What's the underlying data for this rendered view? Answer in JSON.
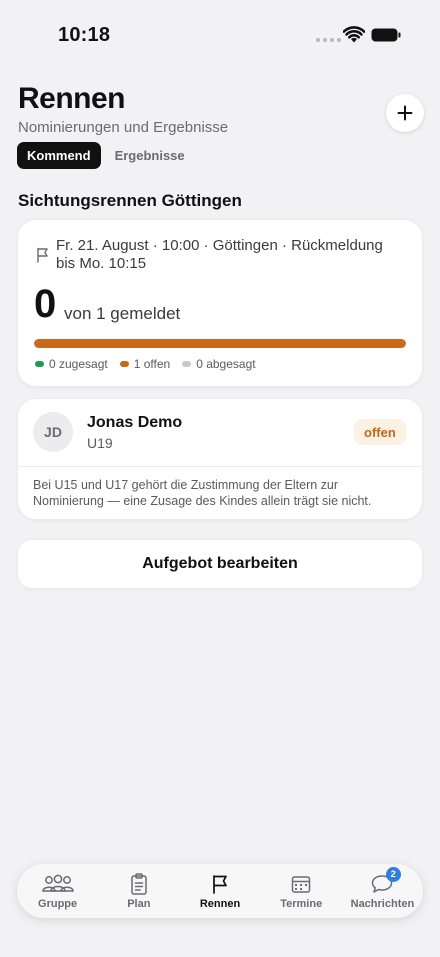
{
  "status_bar": {
    "time": "10:18"
  },
  "header": {
    "title": "Rennen",
    "subtitle": "Nominierungen und Ergebnisse",
    "add_icon": "plus-icon"
  },
  "tabs": [
    {
      "label": "Kommend",
      "active": true
    },
    {
      "label": "Ergebnisse",
      "active": false
    }
  ],
  "race": {
    "heading": "Sichtungsrennen Göttingen",
    "info": "Fr. 21. August · 10:00 · Göttingen · Rückmeldung bis Mo. 10:15",
    "count": "0",
    "count_label": "von 1 gemeldet",
    "progress_open_fraction": 1.0,
    "legend": [
      {
        "label": "0 zugesagt",
        "color": "#1f9a52"
      },
      {
        "label": "1 offen",
        "color": "#c96a1a"
      },
      {
        "label": "0 abgesagt",
        "color": "#c9c9cd"
      }
    ]
  },
  "athlete": {
    "initials": "JD",
    "name": "Jonas Demo",
    "group": "U19",
    "status": "offen",
    "note": "Bei U15 und U17 gehört die Zustimmung der Eltern zur Nominierung — eine Zusage des Kindes allein trägt sie nicht."
  },
  "actions": {
    "edit_label": "Aufgebot bearbeiten"
  },
  "nav": {
    "items": [
      {
        "label": "Gruppe",
        "icon": "group-icon"
      },
      {
        "label": "Plan",
        "icon": "clipboard-icon"
      },
      {
        "label": "Rennen",
        "icon": "flag-icon",
        "active": true
      },
      {
        "label": "Termine",
        "icon": "calendar-icon"
      },
      {
        "label": "Nachrichten",
        "icon": "chat-bubble-icon",
        "badge": "2"
      }
    ]
  },
  "colors": {
    "accent": "#c96a1a",
    "badge_blue": "#2f7de1"
  }
}
